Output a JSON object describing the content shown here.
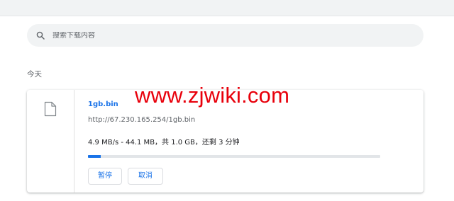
{
  "search": {
    "placeholder": "搜索下载内容",
    "icon": "search-icon"
  },
  "section": {
    "heading": "今天"
  },
  "download": {
    "file_icon": "file-icon",
    "file_name": "1gb.bin",
    "url": "http://67.230.165.254/1gb.bin",
    "status": "4.9 MB/s - 44.1 MB，共 1.0 GB，还剩 3 分钟",
    "progress_fraction": 0.044,
    "pause_label": "暂停",
    "cancel_label": "取消"
  },
  "watermark": {
    "text": "www.zjwiki.com"
  },
  "colors": {
    "accent": "#1a73e8",
    "watermark": "#e8000b",
    "search_bg": "#f1f3f4"
  }
}
